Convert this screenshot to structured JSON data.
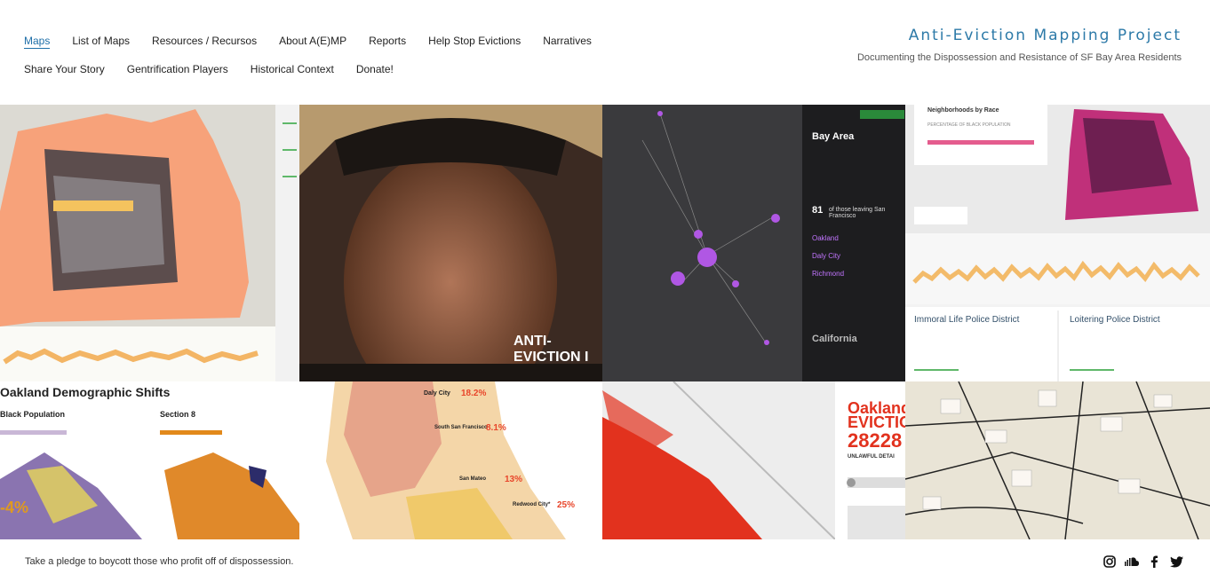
{
  "nav": {
    "items": [
      {
        "label": "Maps"
      },
      {
        "label": "List of Maps"
      },
      {
        "label": "Resources / Recursos"
      },
      {
        "label": "About A(E)MP"
      },
      {
        "label": "Reports"
      },
      {
        "label": "Help Stop Evictions"
      },
      {
        "label": "Narratives"
      },
      {
        "label": "Share Your Story"
      },
      {
        "label": "Gentrification Players"
      },
      {
        "label": "Historical Context"
      },
      {
        "label": "Donate!"
      }
    ],
    "active": "Maps"
  },
  "brand": {
    "title": "Anti-Eviction Mapping Project",
    "subtitle": "Documenting the Dispossession and Resistance of SF Bay Area Residents"
  },
  "tiles": {
    "t2_caption": "ANTI-EVICTION I",
    "t3_title": "Bay Area",
    "t3_moved": "81",
    "t3_text": "of those leaving San Francisco",
    "t3_city1": "Oakland",
    "t3_city2": "Daly City",
    "t3_city3": "Richmond",
    "t3_california": "California",
    "t4_legend": "Neighborhoods by Race",
    "t4_sub": "PERCENTAGE OF BLACK POPULATION",
    "t4_p1": "Immoral Life Police District",
    "t4_p2": "Loitering Police District",
    "t5_title": "Oakland Demographic Shifts",
    "t5_l1": "Black Population",
    "t5_l2": "Section 8",
    "t5_pct": "-4%",
    "t6_daly": "Daly City",
    "t6_daly_v": "18.2%",
    "t6_ssf": "South San Francisco",
    "t6_ssf_v": "8.1%",
    "t6_sm": "San Mateo",
    "t6_sm_v": "13%",
    "t6_rc": "Redwood City*",
    "t6_rc_v": "25%",
    "t7_title": "Oakland",
    "t7_sub": "EVICTIO",
    "t7_num": "28228",
    "t7_desc": "UNLAWFUL DETAI"
  },
  "footer": {
    "text": "Take a pledge to boycott those who profit off of dispossession."
  },
  "social": [
    "instagram-icon",
    "soundcloud-icon",
    "facebook-icon",
    "twitter-icon"
  ]
}
